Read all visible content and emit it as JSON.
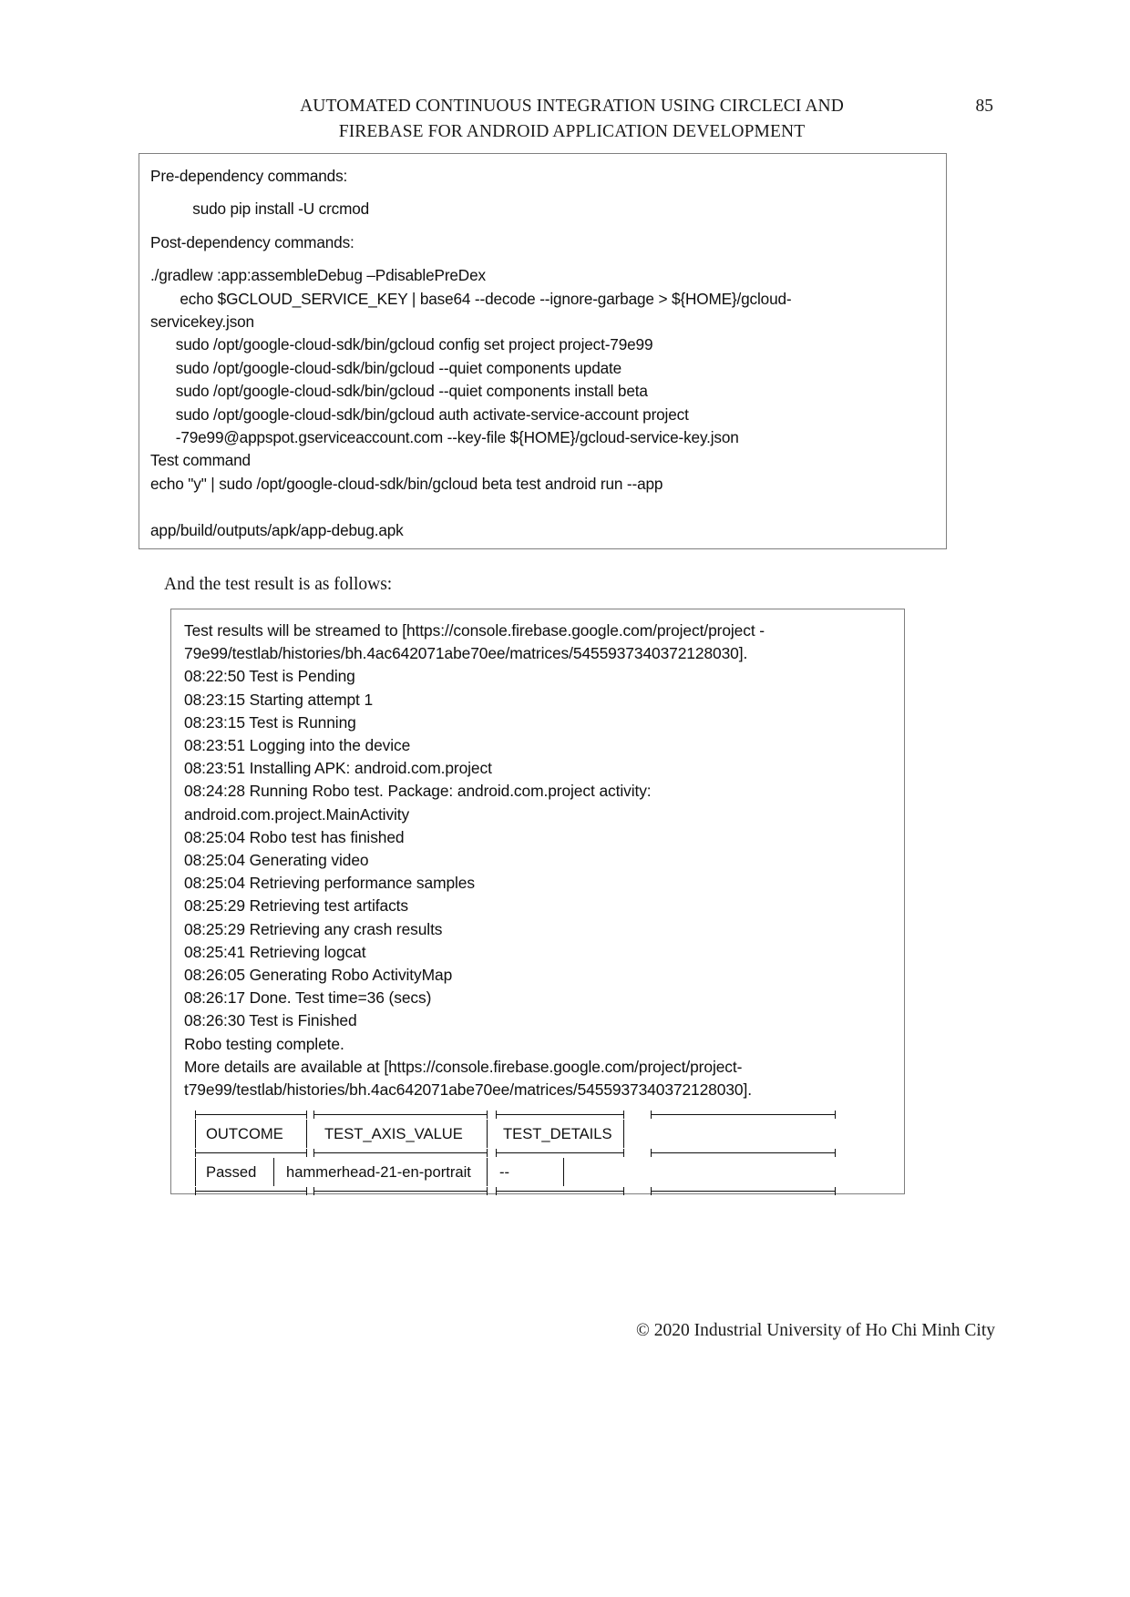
{
  "header": {
    "title_line_1": "AUTOMATED CONTINUOUS INTEGRATION USING CIRCLECI AND",
    "title_line_2": "FIREBASE FOR ANDROID APPLICATION DEVELOPMENT",
    "page_number": "85"
  },
  "config_box": {
    "lines": [
      "Pre-dependency commands:",
      "          sudo pip install -U crcmod",
      "Post-dependency commands:",
      "./gradlew :app:assembleDebug –PdisablePreDex",
      "       echo $GCLOUD_SERVICE_KEY | base64 --decode --ignore-garbage > ${HOME}/gcloud-",
      "servicekey.json",
      "      sudo /opt/google-cloud-sdk/bin/gcloud config set project project-79e99",
      "      sudo /opt/google-cloud-sdk/bin/gcloud --quiet components update",
      "      sudo /opt/google-cloud-sdk/bin/gcloud --quiet components install beta",
      "      sudo /opt/google-cloud-sdk/bin/gcloud auth activate-service-account project",
      "      -79e99@appspot.gserviceaccount.com --key-file ${HOME}/gcloud-service-key.json",
      "Test command",
      "echo \"y\" | sudo /opt/google-cloud-sdk/bin/gcloud beta test android run --app",
      "",
      "app/build/outputs/apk/app-debug.apk"
    ]
  },
  "interstitial": {
    "text": "And the test result is as follows:"
  },
  "result_box": {
    "lines": [
      "Test results will be streamed to [https://console.firebase.google.com/project/project -",
      "79e99/testlab/histories/bh.4ac642071abe70ee/matrices/5455937340372128030].",
      "08:22:50 Test is Pending",
      "08:23:15 Starting attempt 1",
      "08:23:15 Test is Running",
      "08:23:51 Logging into the device",
      "08:23:51 Installing APK: android.com.project",
      "08:24:28 Running Robo test. Package: android.com.project activity:",
      "android.com.project.MainActivity",
      "08:25:04 Robo test has finished",
      "08:25:04 Generating video",
      "08:25:04 Retrieving performance samples",
      "08:25:29 Retrieving test artifacts",
      "08:25:29 Retrieving any crash results",
      "08:25:41 Retrieving logcat",
      "08:26:05 Generating Robo ActivityMap",
      "08:26:17 Done. Test time=36 (secs)",
      "08:26:30 Test is Finished",
      "Robo testing complete.",
      "More details are available at [https://console.firebase.google.com/project/project-",
      "t79e99/testlab/histories/bh.4ac642071abe70ee/matrices/5455937340372128030]."
    ],
    "table": {
      "headers": [
        "OUTCOME",
        "TEST_AXIS_VALUE",
        "TEST_DETAILS"
      ],
      "rows": [
        [
          "Passed",
          "hammerhead-21-en-portrait",
          "--"
        ]
      ]
    }
  },
  "footer": {
    "copyright": "© 2020 Industrial University of Ho Chi Minh City"
  }
}
